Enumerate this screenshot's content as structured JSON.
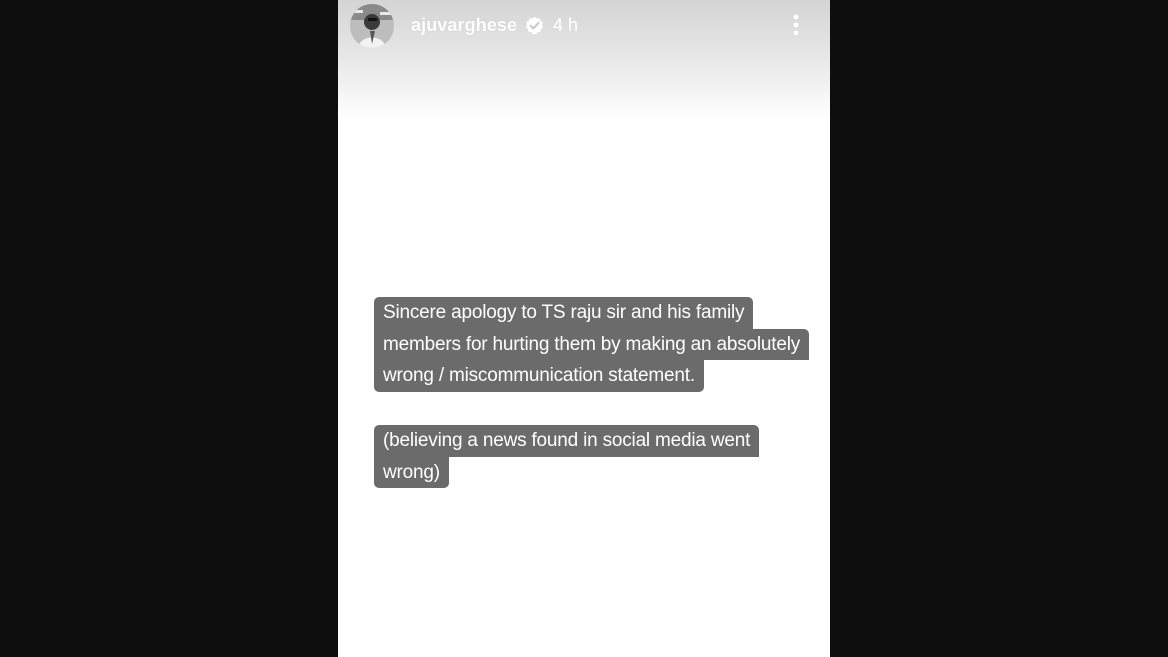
{
  "story": {
    "username": "ajuvarghese",
    "timestamp": "4 h",
    "verified_icon": "verified-badge-icon",
    "more_icon": "more-vertical-icon",
    "captions": [
      {
        "lines": [
          "Sincere apology to TS raju sir and his family",
          "members for hurting them by making an absolutely",
          "wrong / miscommunication statement."
        ]
      },
      {
        "lines": [
          "(believing a news found in social media went",
          "wrong)"
        ]
      }
    ]
  },
  "colors": {
    "background": "#0e0e0e",
    "story_background": "#ffffff",
    "caption_background": "#6b6b6b",
    "caption_text": "#ffffff"
  }
}
